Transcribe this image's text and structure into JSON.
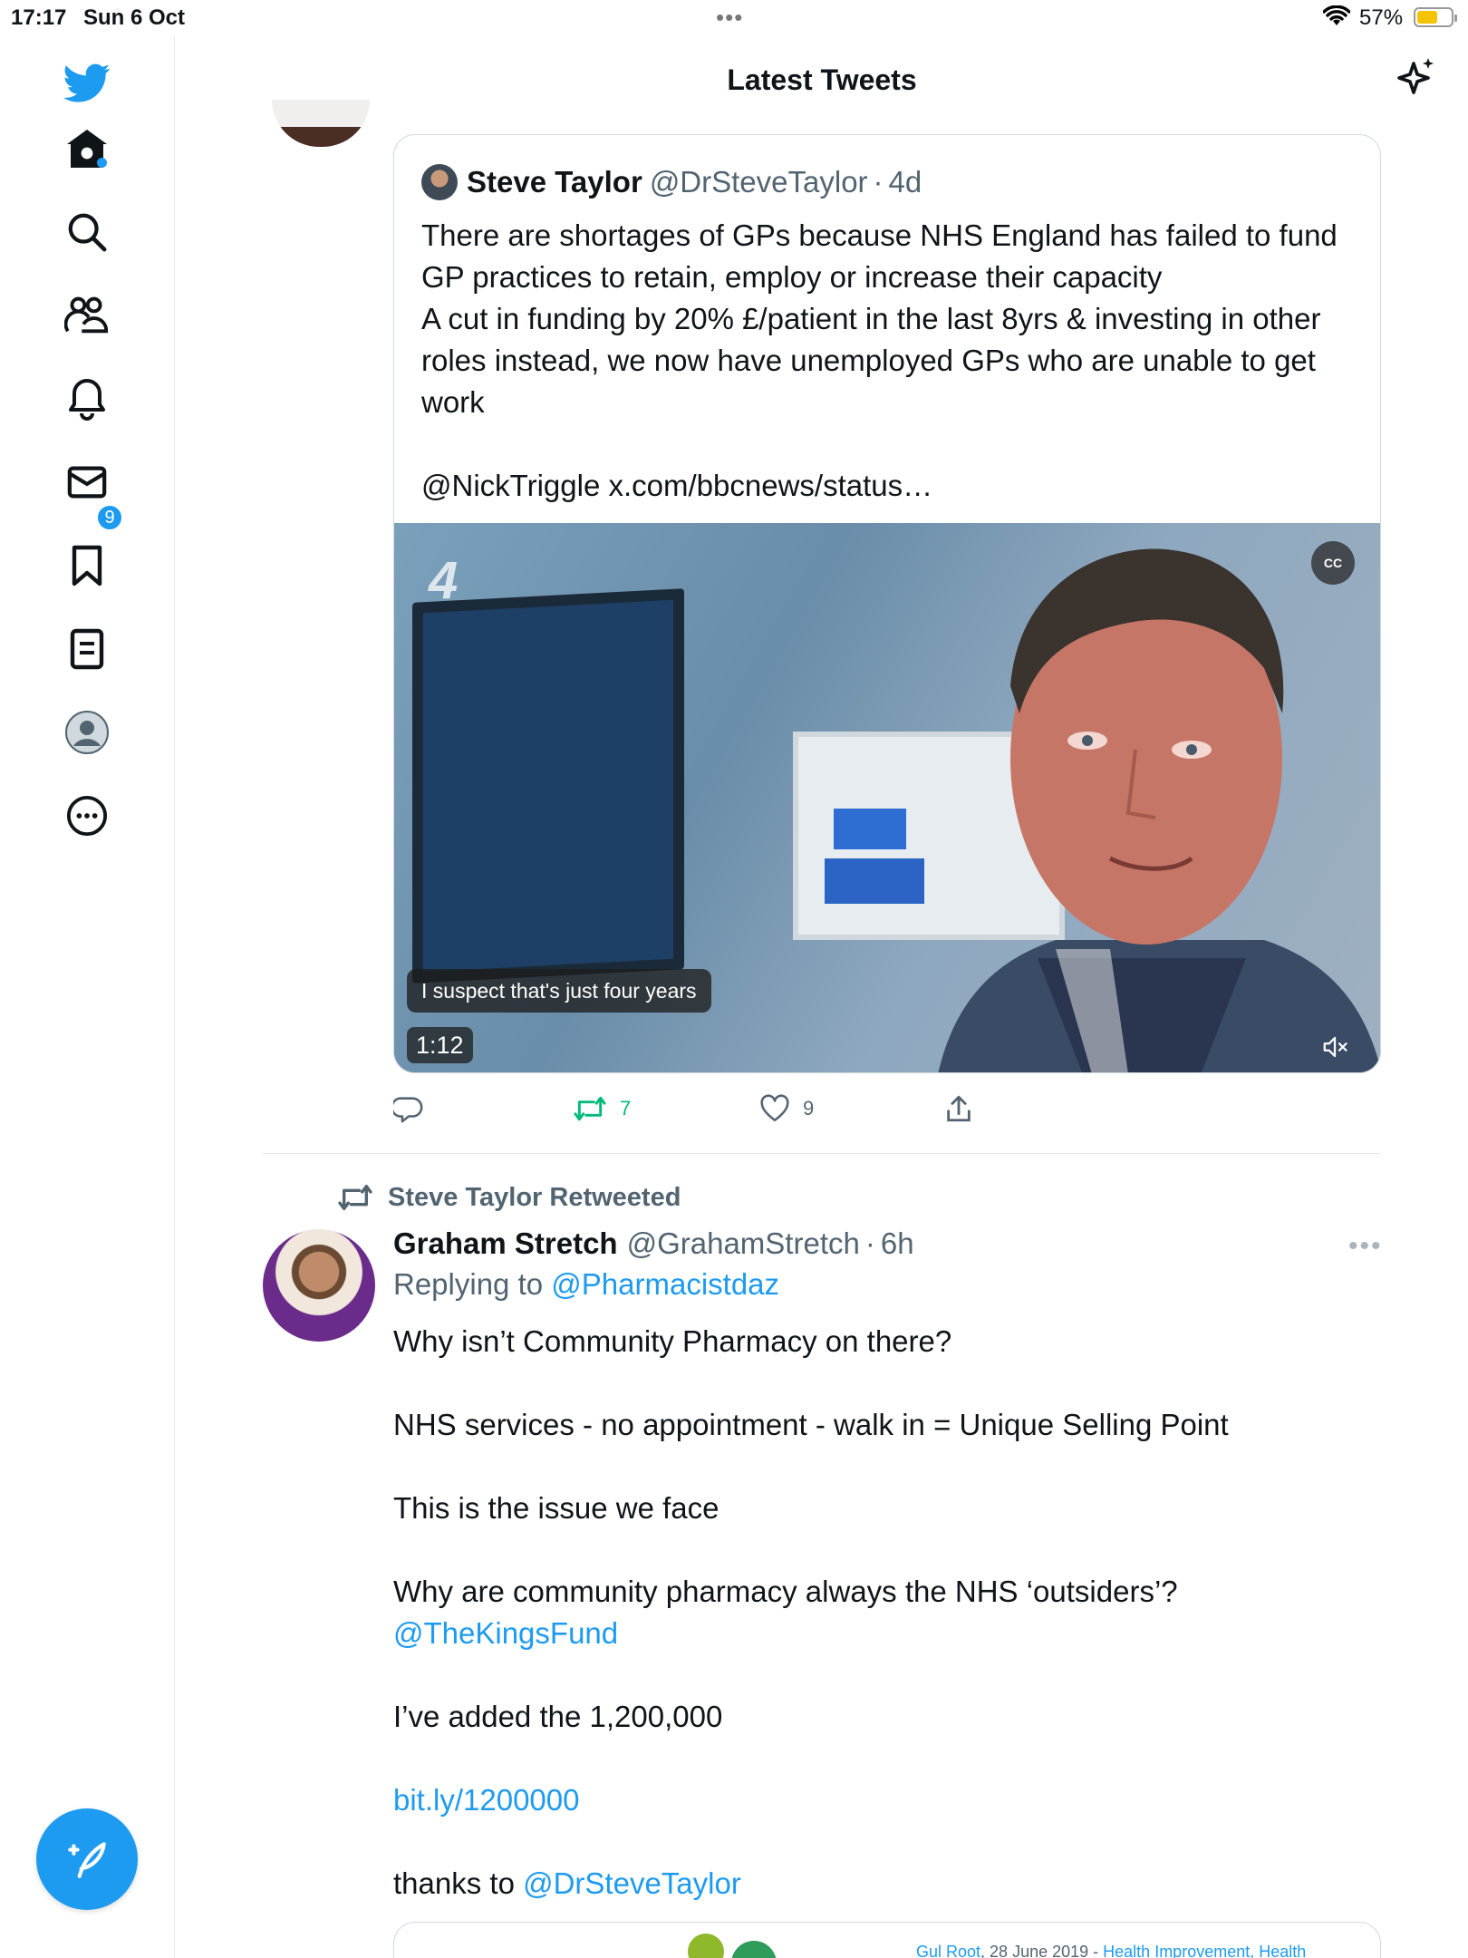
{
  "status_bar": {
    "time": "17:17",
    "date": "Sun 6 Oct",
    "battery": "57%",
    "battery_color": "#f5c400"
  },
  "sidebar": {
    "brand_icon": "twitter-bird-icon",
    "items": [
      {
        "name": "home",
        "icon": "home-icon"
      },
      {
        "name": "search",
        "icon": "search-icon"
      },
      {
        "name": "communities",
        "icon": "people-icon"
      },
      {
        "name": "notifications",
        "icon": "bell-icon",
        "badge": "9"
      },
      {
        "name": "messages",
        "icon": "mail-icon"
      },
      {
        "name": "bookmarks",
        "icon": "bookmark-icon"
      },
      {
        "name": "lists",
        "icon": "list-icon"
      },
      {
        "name": "profile",
        "icon": "avatar-icon"
      },
      {
        "name": "more",
        "icon": "more-circle-icon"
      }
    ],
    "compose_icon": "compose-feather-icon",
    "accent": "#1d9bf0"
  },
  "header": {
    "title": "Latest Tweets",
    "sparkle_icon": "sparkle-icon"
  },
  "quoted_tweet": {
    "name": "Steve Taylor",
    "handle": "@DrSteveTaylor",
    "separator": "·",
    "time": "4d",
    "text": "There are shortages of GPs because NHS England has failed to fund GP practices to retain, employ or increase their capacity\nA cut in funding by 20% £/patient in the last 8yrs & investing in other roles instead, we now have unemployed GPs who are unable to get work\n\n@NickTriggle x.com/bbcnews/status…",
    "video": {
      "caption": "I suspect that's just four years",
      "duration": "1:12",
      "cc_label": "CC",
      "logo": "4"
    }
  },
  "actions": {
    "reply_count": "",
    "retweet_count": "7",
    "like_count": "9"
  },
  "tweet2": {
    "retweeted_by": "Steve Taylor Retweeted",
    "name": "Graham Stretch",
    "handle": "@GrahamStretch",
    "separator": "·",
    "time": "6h",
    "more": "•••",
    "replying_prefix": "Replying to",
    "replying_to": "@Pharmacistdaz",
    "p1": "Why isn’t Community Pharmacy on there?",
    "p2": "NHS services - no appointment - walk in = Unique Selling Point",
    "p3": "This is the issue we face",
    "p4": "Why are community pharmacy always the NHS ‘outsiders’?",
    "p4_link": "@TheKingsFund",
    "p5": "I’ve added the 1,200,000",
    "p6_link": "bit.ly/1200000",
    "p7": "thanks to",
    "p7_link": "@DrSteveTaylor",
    "card": {
      "author": "Gul Root",
      "date": ", 28 June 2019 - ",
      "tags": "Health Improvement, Health"
    }
  }
}
